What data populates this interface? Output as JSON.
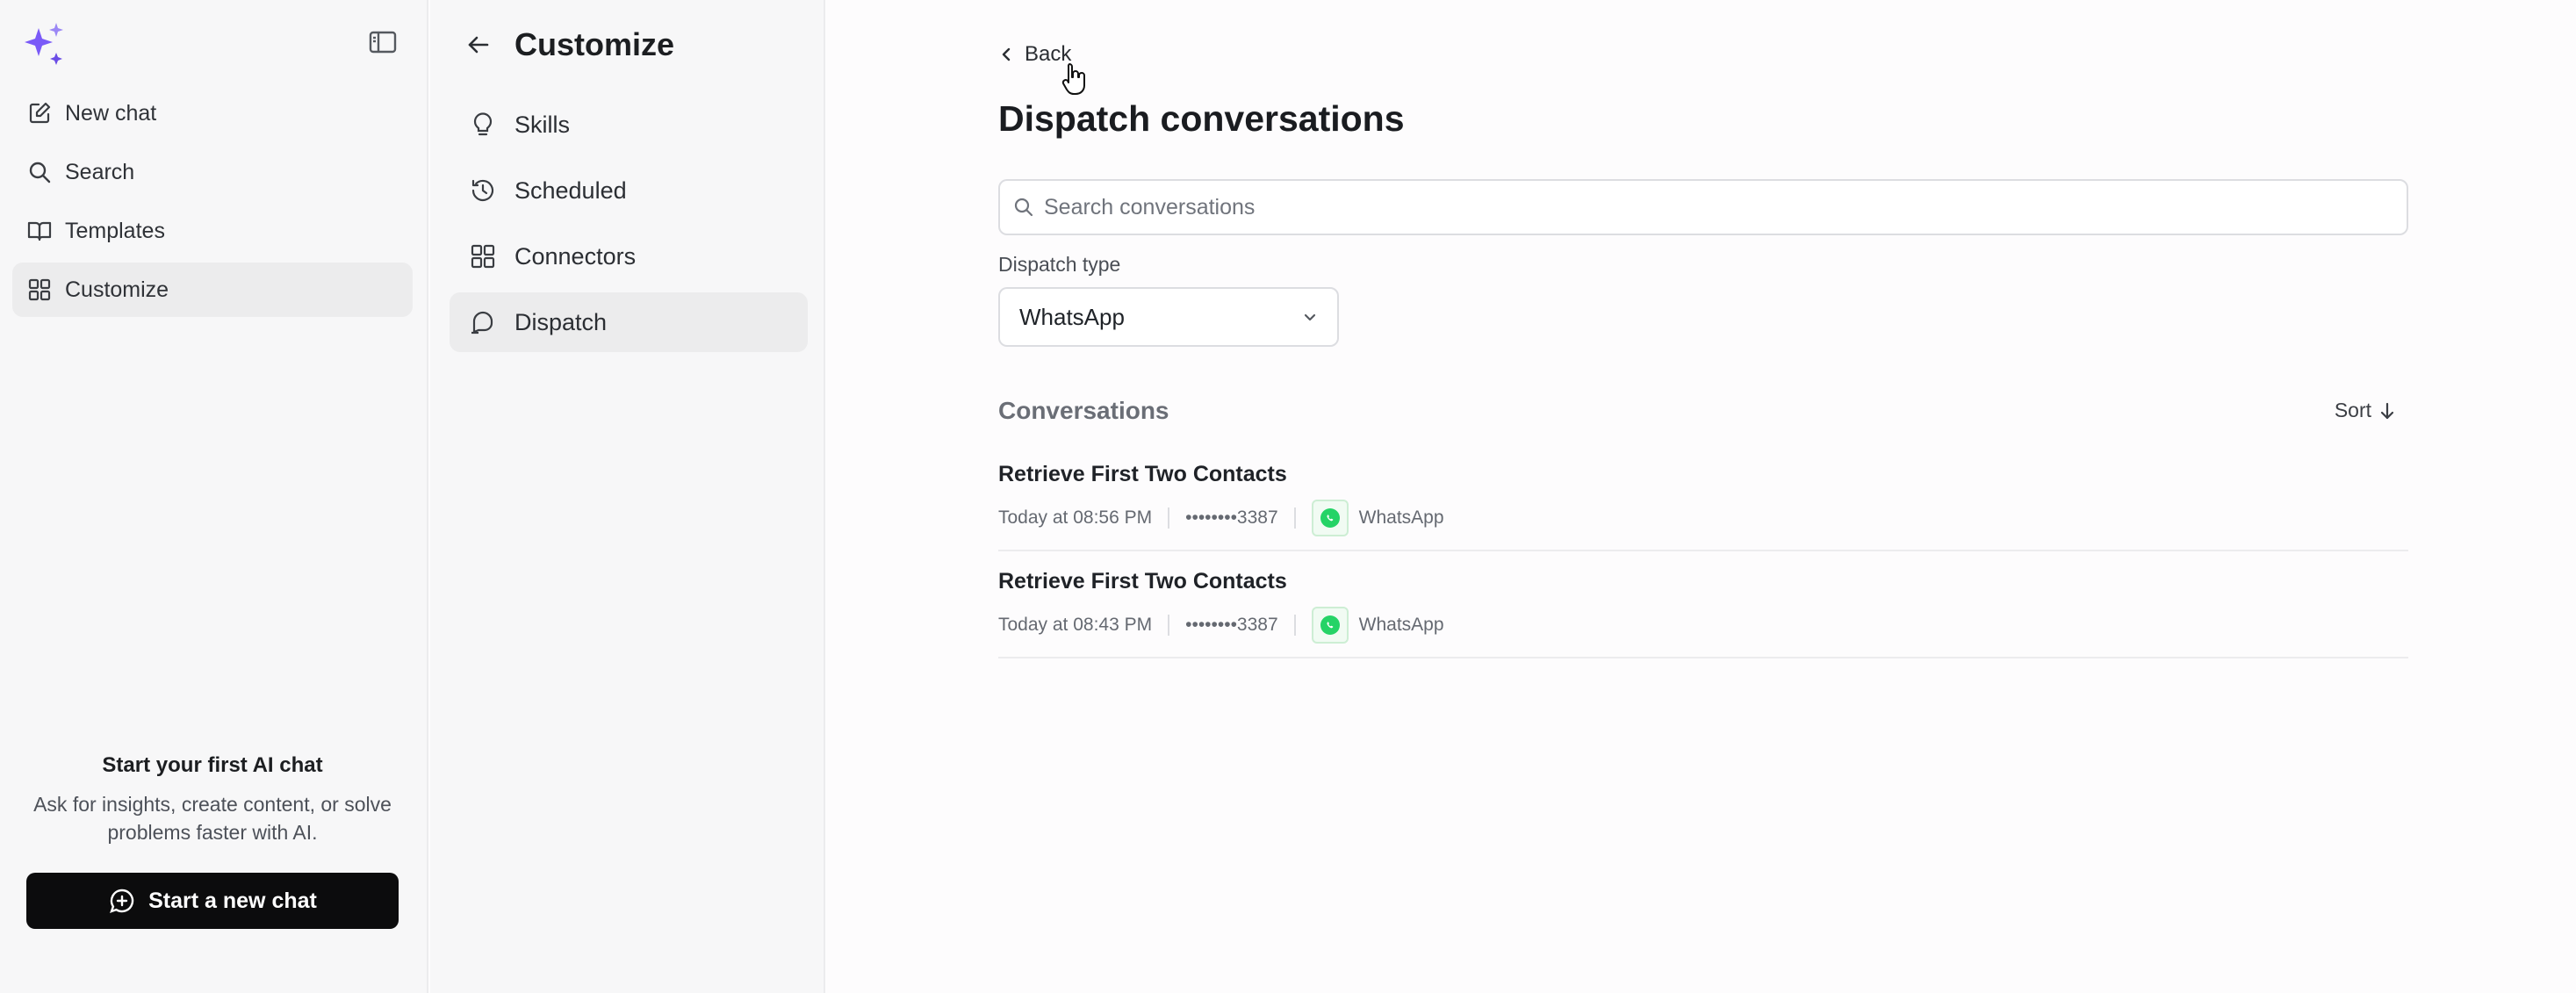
{
  "sidebar": {
    "items": [
      {
        "label": "New chat",
        "icon": "edit-icon"
      },
      {
        "label": "Search",
        "icon": "search-icon"
      },
      {
        "label": "Templates",
        "icon": "book-icon"
      },
      {
        "label": "Customize",
        "icon": "grid-icon",
        "active": true
      }
    ],
    "promo_title": "Start your first AI chat",
    "promo_text": "Ask for insights, create content, or solve problems faster with AI.",
    "cta_label": "Start a new chat"
  },
  "panel": {
    "title": "Customize",
    "items": [
      {
        "label": "Skills",
        "icon": "lightbulb-icon"
      },
      {
        "label": "Scheduled",
        "icon": "clock-history-icon"
      },
      {
        "label": "Connectors",
        "icon": "grid-icon"
      },
      {
        "label": "Dispatch",
        "icon": "chat-bubble-icon",
        "active": true
      }
    ]
  },
  "main": {
    "back_label": "Back",
    "title": "Dispatch conversations",
    "search_placeholder": "Search conversations",
    "dispatch_type_label": "Dispatch type",
    "dispatch_type_value": "WhatsApp",
    "section_title": "Conversations",
    "sort_label": "Sort",
    "conversations": [
      {
        "title": "Retrieve First Two Contacts",
        "time": "Today at 08:56 PM",
        "phone": "••••••••3387",
        "channel": "WhatsApp"
      },
      {
        "title": "Retrieve First Two Contacts",
        "time": "Today at 08:43 PM",
        "phone": "••••••••3387",
        "channel": "WhatsApp"
      }
    ]
  },
  "colors": {
    "accent": "#7a5af8",
    "whatsapp": "#25d366",
    "cta_bg": "#0c0c0d"
  }
}
